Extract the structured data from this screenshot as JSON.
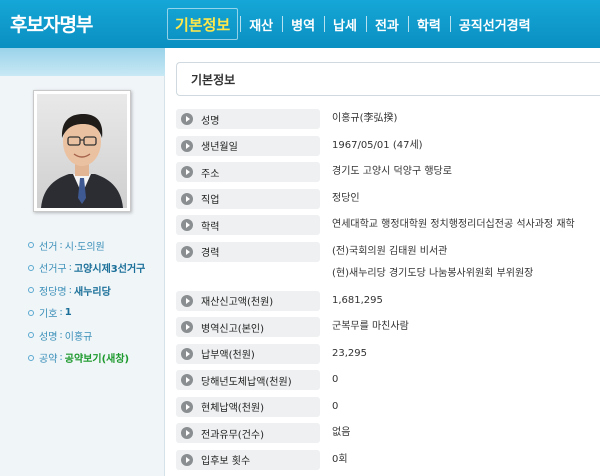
{
  "header": {
    "title": "후보자명부",
    "tabs": [
      {
        "label": "기본정보",
        "active": true
      },
      {
        "label": "재산",
        "active": false
      },
      {
        "label": "병역",
        "active": false
      },
      {
        "label": "납세",
        "active": false
      },
      {
        "label": "전과",
        "active": false
      },
      {
        "label": "학력",
        "active": false
      },
      {
        "label": "공직선거경력",
        "active": false
      }
    ]
  },
  "sidebar": {
    "items": [
      {
        "label": "선거",
        "value": "시·도의원"
      },
      {
        "label": "선거구",
        "value": "고양시제3선거구"
      },
      {
        "label": "정당명",
        "value": "새누리당"
      },
      {
        "label": "기호",
        "value": "1"
      },
      {
        "label": "성명",
        "value": "이홍규"
      },
      {
        "label": "공약",
        "value": "공약보기(새창)"
      }
    ]
  },
  "section": {
    "title": "기본정보"
  },
  "fields": [
    {
      "label": "성명",
      "value": "이홍규(李弘揆)"
    },
    {
      "label": "생년월일",
      "value": "1967/05/01 (47세)"
    },
    {
      "label": "주소",
      "value": "경기도 고양시 덕양구 행당로"
    },
    {
      "label": "직업",
      "value": "정당인"
    },
    {
      "label": "학력",
      "value": "연세대학교 행정대학원 정치행정리더십전공 석사과정 재학"
    },
    {
      "label": "경력",
      "lines": [
        "(전)국회의원 김태원 비서관",
        "(현)새누리당 경기도당 나눔봉사위원회 부위원장"
      ]
    },
    {
      "label": "재산신고액(천원)",
      "value": "1,681,295"
    },
    {
      "label": "병역신고(본인)",
      "value": "군복무를 마친사람"
    },
    {
      "label": "납부액(천원)",
      "value": "23,295"
    },
    {
      "label": "당해년도체납액(천원)",
      "value": "0"
    },
    {
      "label": "현체납액(천원)",
      "value": "0"
    },
    {
      "label": "전과유무(건수)",
      "value": "없음"
    },
    {
      "label": "입후보 횟수",
      "value": "0회"
    }
  ],
  "colors": {
    "header_bg": "#0a8fc1",
    "active_tab": "#ffe84a",
    "sidebar_text": "#3a8fb8",
    "party_green": "#1e9a2e"
  }
}
